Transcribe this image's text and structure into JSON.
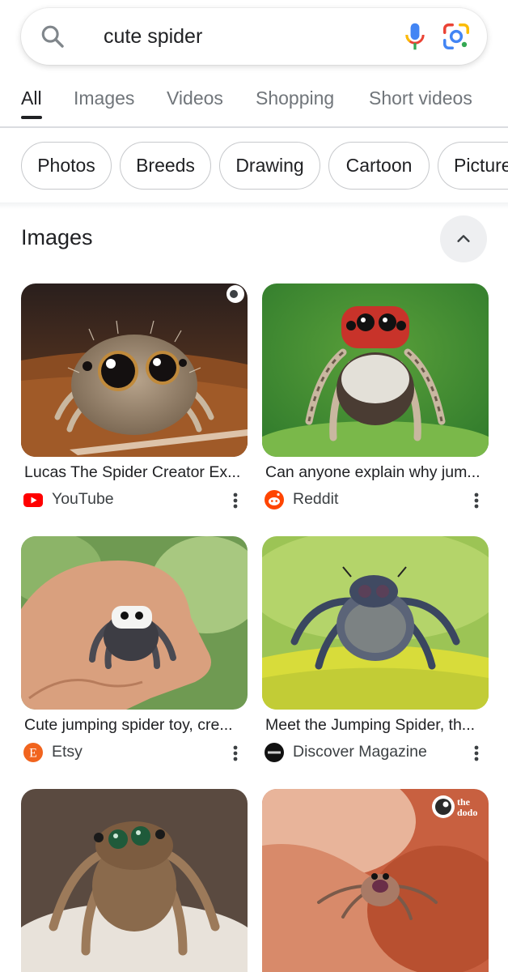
{
  "search": {
    "query": "cute spider"
  },
  "tabs": [
    {
      "label": "All",
      "active": true
    },
    {
      "label": "Images",
      "active": false
    },
    {
      "label": "Videos",
      "active": false
    },
    {
      "label": "Shopping",
      "active": false
    },
    {
      "label": "Short videos",
      "active": false
    }
  ],
  "chips": [
    "Photos",
    "Breeds",
    "Drawing",
    "Cartoon",
    "Picture"
  ],
  "images_section": {
    "title": "Images",
    "results": [
      {
        "caption": "Lucas The Spider Creator Ex...",
        "source": "YouTube",
        "source_icon": "youtube-logo"
      },
      {
        "caption": "Can anyone explain why jum...",
        "source": "Reddit",
        "source_icon": "reddit-logo"
      },
      {
        "caption": "Cute jumping spider toy, cre...",
        "source": "Etsy",
        "source_icon": "etsy-logo"
      },
      {
        "caption": "Meet the Jumping Spider, th...",
        "source": "Discover Magazine",
        "source_icon": "discover-logo"
      },
      {
        "caption": "",
        "source": "",
        "source_icon": ""
      },
      {
        "caption": "",
        "source": "",
        "source_icon": ""
      }
    ],
    "watermark": {
      "line1": "the",
      "line2": "dodo"
    }
  },
  "colors": {
    "youtube": "#ff0000",
    "reddit": "#ff4500",
    "etsy": "#f1641e",
    "google_blue": "#4285f4",
    "google_red": "#ea4335",
    "google_yellow": "#fbbc04",
    "google_green": "#34a853"
  }
}
